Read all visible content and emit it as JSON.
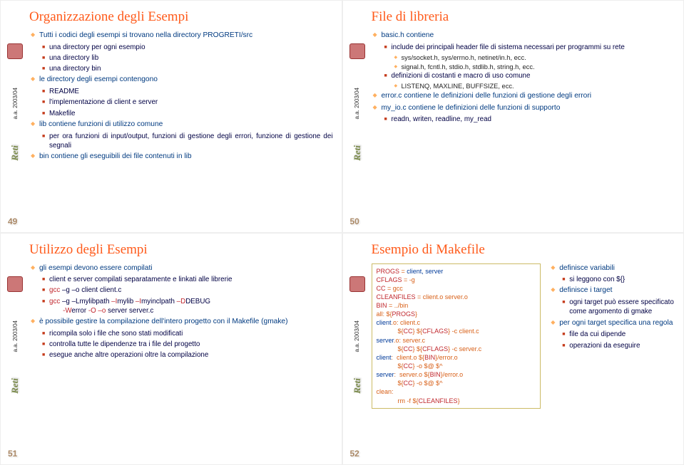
{
  "meta": {
    "year": "a.a. 2003/04",
    "brand": "Reti"
  },
  "slides": [
    {
      "pageno": "49",
      "title": "Organizzazione degli Esempi",
      "b1_0": "Tutti i codici degli esempi si trovano nella directory PROGRETI/src",
      "b2_0": "una directory per ogni esempio",
      "b2_1": "una directory lib",
      "b2_2": "una directory bin",
      "b1_1": "le directory degli esempi contengono",
      "b2_3": "README",
      "b2_4": "l'implementazione di client e server",
      "b2_5": "Makefile",
      "b1_2": "lib contiene funzioni di utilizzo comune",
      "b2_6": "per ora funzioni di input/output, funzioni di gestione degli errori, funzione di gestione dei segnali",
      "b1_3": "bin contiene gli eseguibili dei file contenuti in lib"
    },
    {
      "pageno": "50",
      "title": "File di libreria",
      "b1_0": "basic.h contiene",
      "b2_0": "include dei principali header file di sistema necessari per programmi su rete",
      "b3_0": "sys/socket.h, sys/errno.h, netinet/in.h, ecc.",
      "b3_1": "signal.h, fcntl.h, stdio.h, stdlib.h, string.h, ecc.",
      "b2_1": "definizioni di costanti e macro di uso comune",
      "b3_2": "LISTENQ, MAXLINE, BUFFSIZE, ecc.",
      "b1_1": "error.c contiene le definizioni delle funzioni di gestione degli errori",
      "b1_2": "my_io.c contiene le definizioni delle funzioni di supporto",
      "b2_2": "readn, writen, readline, my_read"
    },
    {
      "pageno": "51",
      "title": "Utilizzo degli Esempi",
      "b1_0": "gli esempi devono essere compilati",
      "b2_0": "client e server compilati separatamente e linkati alle librerie",
      "b2_1a": "gcc",
      "b2_1b": " –g –o",
      "b2_1c": " client client.c",
      "b2_2a": "gcc",
      "b2_2b": " –g –L",
      "b2_2c": "mylibpath ",
      "b2_2d": "–I",
      "b2_2e": "mylib ",
      "b2_2f": "–I",
      "b2_2g": "myinclpath ",
      "b2_2h": "–D",
      "b2_2i": "DEBUG",
      "b2_2_line2a": "-W",
      "b2_2_line2b": "error ",
      "b2_2_line2c": "-O –o",
      "b2_2_line2d": " server server.c",
      "b1_1": "è possibile gestire la compilazione dell'intero progetto con il Makefile (gmake)",
      "b2_3": "ricompila solo i file che sono stati modificati",
      "b2_4": "controlla tutte le dipendenze tra i file del progetto",
      "b2_5": "esegue anche altre operazioni oltre la compilazione"
    },
    {
      "pageno": "52",
      "title": "Esempio di Makefile",
      "make": {
        "l1a": "PROGS",
        "l1b": " = ",
        "l1c": "client, server",
        "l2a": "CFLAGS",
        "l2b": " = -g",
        "l3a": "CC",
        "l3b": " = gcc",
        "l4a": "CLEANFILES",
        "l4b": " = client.o server.o",
        "l5a": "BIN",
        "l5b": " = ../bin",
        "l6": "all: ${",
        "l6b": "PROGS",
        "l6c": "}",
        "l7a": "client",
        "l7b": ".o: client.c",
        "l8a": "            ${",
        "l8b": "CC",
        "l8c": "} ${",
        "l8d": "CFLAGS",
        "l8e": "} -c client.c",
        "l9a": "server",
        "l9b": ".o: server.c",
        "l10a": "            ${",
        "l10b": "CC",
        "l10c": "} ${",
        "l10d": "CFLAGS",
        "l10e": "} -c server.c",
        "l11a": "client",
        "l11b": ": ",
        "l11c": " client.o ${",
        "l11d": "BIN",
        "l11e": "}/error.o",
        "l12a": "            ${",
        "l12b": "CC",
        "l12c": "} -o $@ $^",
        "l13a": "server",
        "l13b": ": ",
        "l13c": " server.o ${",
        "l13d": "BIN",
        "l13e": "}/error.o",
        "l14a": "            ${",
        "l14b": "CC",
        "l14c": "} -o $@ $^",
        "l15": "clean:",
        "l16a": "            rm -f ${",
        "l16b": "CLEANFILES",
        "l16c": "}"
      },
      "right": {
        "b1_0": "definisce variabili",
        "b2_0": "si leggono con ${}",
        "b1_1": "definisce i target",
        "b2_1": "ogni target può essere specificato come argomento di gmake",
        "b1_2": "per ogni target specifica una regola",
        "b2_2": "file da cui dipende",
        "b2_3": "operazioni da eseguire"
      }
    }
  ]
}
